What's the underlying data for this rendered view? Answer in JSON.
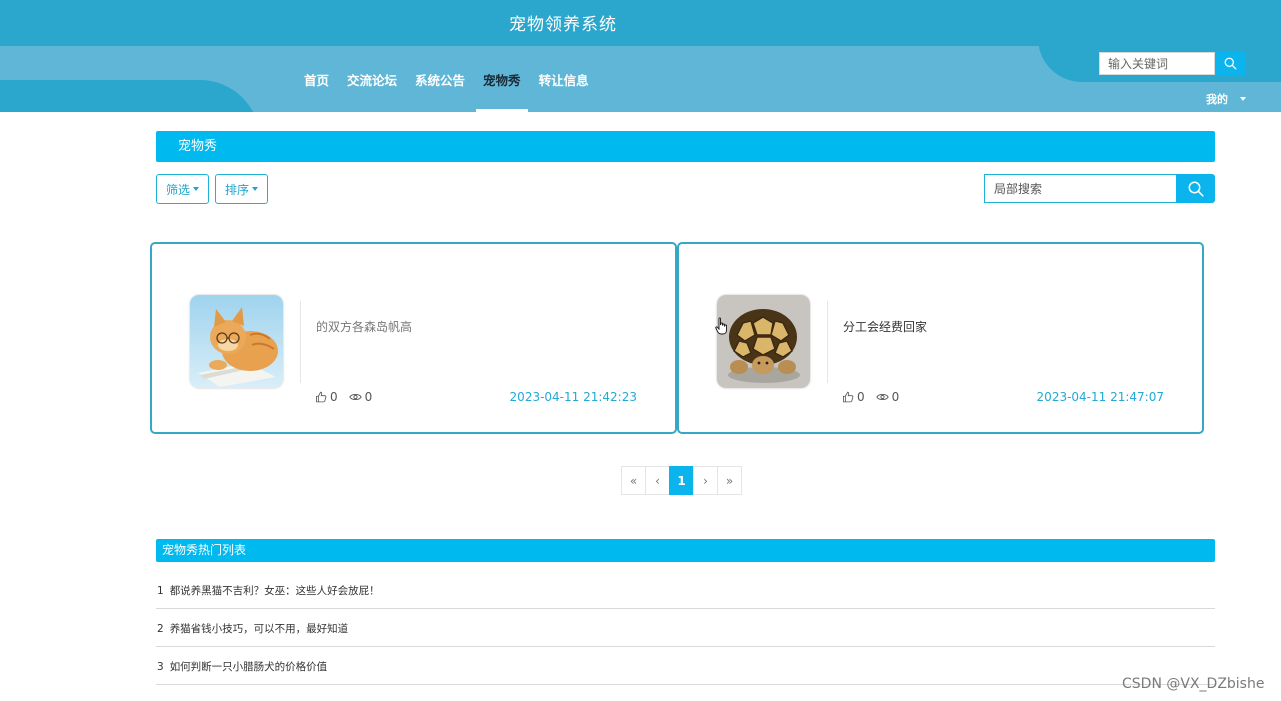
{
  "header": {
    "site_title": "宠物领养系统",
    "nav": [
      {
        "label": "首页"
      },
      {
        "label": "交流论坛"
      },
      {
        "label": "系统公告"
      },
      {
        "label": "宠物秀",
        "active": true
      },
      {
        "label": "转让信息"
      }
    ],
    "search_placeholder": "输入关键词",
    "user_menu_label": "我的"
  },
  "section": {
    "title": "宠物秀",
    "filter_label": "筛选",
    "sort_label": "排序",
    "local_search_placeholder": "局部搜索"
  },
  "cards": [
    {
      "title": "的双方各森岛帆高",
      "likes": "0",
      "views": "0",
      "date": "2023-04-11 21:42:23",
      "image": "orange-cat-reading-photo"
    },
    {
      "title": "分工会经费回家",
      "likes": "0",
      "views": "0",
      "date": "2023-04-11 21:47:07",
      "image": "tortoise-photo"
    }
  ],
  "pagination": {
    "first": "«",
    "prev": "‹",
    "current": "1",
    "next": "›",
    "last": "»"
  },
  "hot": {
    "title": "宠物秀热门列表",
    "items": [
      {
        "num": "1",
        "text": "都说养黑猫不吉利？女巫：这些人好会放屁！"
      },
      {
        "num": "2",
        "text": "养猫省钱小技巧，可以不用，最好知道"
      },
      {
        "num": "3",
        "text": "如何判断一只小腊肠犬的价格价值"
      }
    ]
  },
  "watermark": "CSDN @VX_DZbishe",
  "colors": {
    "header_dark": "#2ba7cd",
    "header_light": "#5fb6d6",
    "accent": "#00b9ef",
    "card_border": "#36a7c4",
    "date_text": "#22a9d6"
  }
}
